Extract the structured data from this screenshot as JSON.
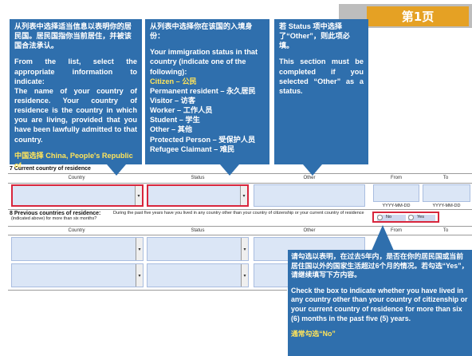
{
  "page_badge": "第1页",
  "callouts": {
    "country": {
      "zh_title": "从列表中选择适当信息以表明你的居民国。居民国指你当前居住，并被该国合法承认。",
      "en_body": "From the list, select the appropriate information to indicate:\nThe name of your country of residence. Your country of residence is the country in which you are living, provided that you have been lawfully admitted to that country.",
      "note": "中国选择 China, People's Republic of"
    },
    "status": {
      "title": "从列表中选择你在该国的入境身份：",
      "intro": "Your immigration status in that country (indicate one of the following):",
      "options": [
        "Citizen – 公民",
        "Permanent resident – 永久居民",
        "Visitor – 访客",
        "Worker – 工作人员",
        "Student – 学生",
        "Other – 其他",
        "Protected Person – 受保护人员",
        "Refugee Claimant – 难民"
      ]
    },
    "other": {
      "zh": "若 Status 项中选择了“Other”，则此项必填。",
      "en": "This section must be completed if you selected “Other” as a status."
    },
    "previous": {
      "zh": "请勾选以表明，在过去5年内，是否在你的居民国或当前居住国以外的国家生活超过6个月的情况。若勾选“Yes”，请继续填写下方内容。",
      "en": "Check the box to indicate whether you have lived in any country other than your country of citizenship or your current country of residence for more than six (6) months in the past five (5) years.",
      "note": "通常勾选“No”"
    }
  },
  "form": {
    "section7": {
      "title": "7  Current country of residence",
      "columns": [
        "Country",
        "Status",
        "Other",
        "From",
        "To"
      ],
      "date_placeholder": "YYYY-MM-DD"
    },
    "section8": {
      "title": "8  Previous countries of residence:",
      "question": "During the past five years have you lived in any country other than your country of citizenship or your current country of residence (indicated above) for more than six months?",
      "options": [
        "No",
        "Yes"
      ],
      "columns": [
        "Country",
        "Status",
        "Other",
        "From",
        "To"
      ]
    }
  }
}
